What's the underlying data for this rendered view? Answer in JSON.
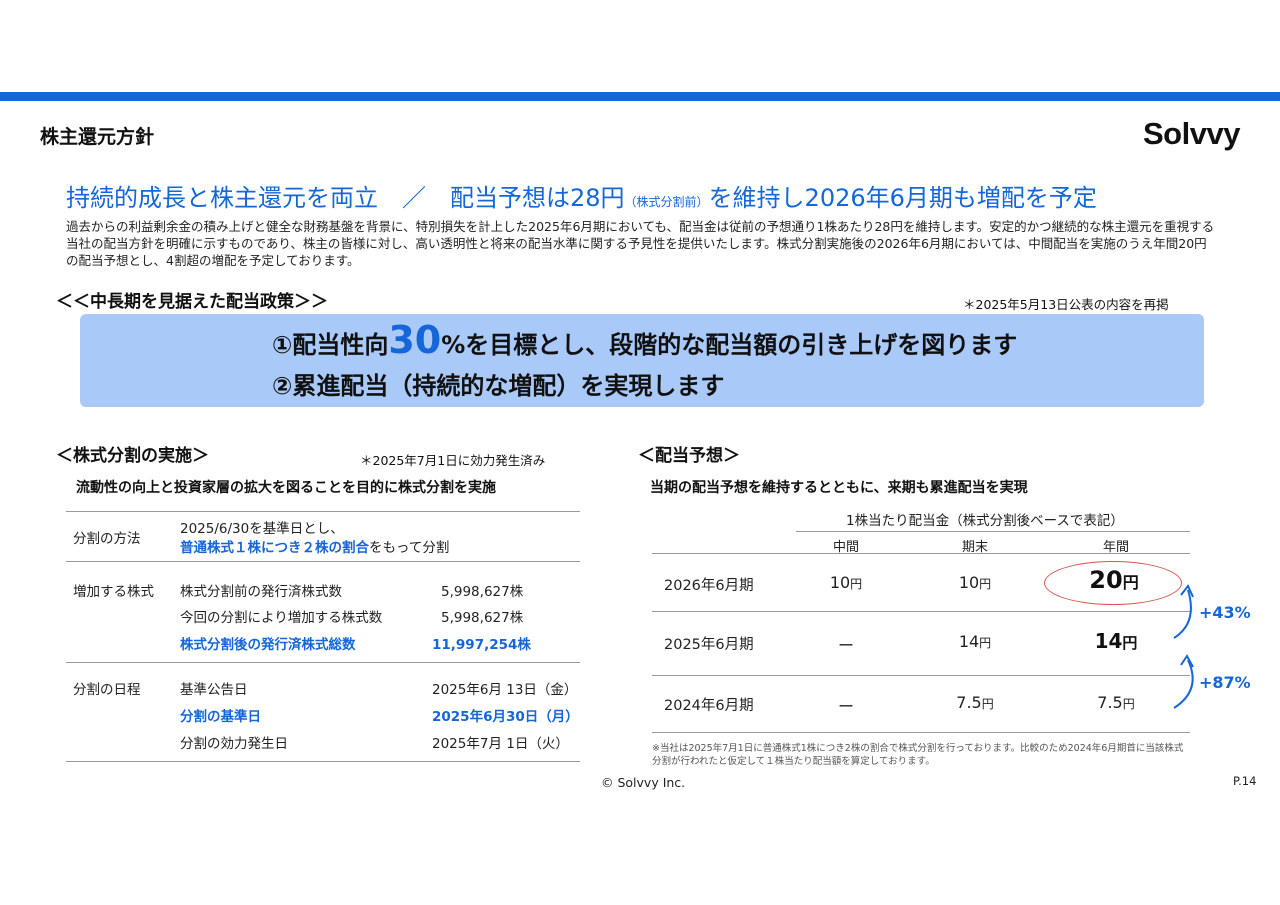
{
  "page_title": "株主還元方針",
  "logo": "Solvvy",
  "headline": {
    "part1": "持続的成長と株主還元を両立　／　配当予想は28円",
    "small": "（株式分割前）",
    "part2": "を維持し2026年6月期も増配を予定"
  },
  "intro_text": "過去からの利益剰余金の積み上げと健全な財務基盤を背景に、特別損失を計上した2025年6月期においても、配当金は従前の予想通り1株あたり28円を維持します。安定的かつ継続的な株主還元を重視する当社の配当方針を明確に示すものであり、株主の皆様に対し、高い透明性と将来の配当水準に関する予見性を提供いたします。株式分割実施後の2026年6月期においては、中間配当を実施のうえ年間20円の配当予想とし、4割超の増配を予定しております。",
  "policy": {
    "heading": "＜＜中長期を見据えた配当政策＞＞",
    "note": "＊2025年5月13日公表の内容を再掲",
    "line1_pre": "①配当性向",
    "line1_big": "30",
    "line1_post": "%を目標とし、段階的な配当額の引き上げを図ります",
    "line2": "②累進配当（持続的な増配）を実現します"
  },
  "split": {
    "heading": "＜株式分割の実施＞",
    "note": "＊2025年7月1日に効力発生済み",
    "subheading": "流動性の向上と投資家層の拡大を図ることを目的に株式分割を実施",
    "method_label": "分割の方法",
    "method_line1": "2025/6/30を基準日とし、",
    "method_line2_blue": "普通株式１株につき２株の割合",
    "method_line2_rest": "をもって分割",
    "increase_label": "増加する株式",
    "increase_rows": [
      {
        "label": "株式分割前の発行済株式数",
        "value": "5,998,627株"
      },
      {
        "label": "今回の分割により増加する株式数",
        "value": "5,998,627株"
      },
      {
        "label": "株式分割後の発行済株式総数",
        "value": "11,997,254株"
      }
    ],
    "schedule_label": "分割の日程",
    "schedule_rows": [
      {
        "label": "基準公告日",
        "value": "2025年6月 13日（金）"
      },
      {
        "label": "分割の基準日",
        "value": "2025年6月30日（月）"
      },
      {
        "label": "分割の効力発生日",
        "value": "2025年7月  1日（火）"
      }
    ]
  },
  "dividend": {
    "heading": "＜配当予想＞",
    "subheading": "当期の配当予想を維持するとともに、来期も累進配当を実現",
    "table_caption": "1株当たり配当金（株式分割後ベースで表記）",
    "columns": [
      "中間",
      "期末",
      "年間"
    ],
    "unit": "円",
    "rows": [
      {
        "period": "2026年6月期",
        "interim": "10",
        "year_end": "10",
        "annual": "20"
      },
      {
        "period": "2025年6月期",
        "interim": "ー",
        "year_end": "14",
        "annual": "14"
      },
      {
        "period": "2024年6月期",
        "interim": "ー",
        "year_end": "7.5",
        "annual": "7.5"
      }
    ],
    "growth_1": "+43%",
    "growth_2": "+87%",
    "highlight_color": "#d9534f",
    "footnote": "※当社は2025年7月1日に普通株式1株につき2株の割合で株式分割を行っております。比較のため2024年6月期首に当該株式分割が行われたと仮定して１株当たり配当額を算定しております。"
  },
  "footer": {
    "copyright": "© Solvvy Inc.",
    "page_number": "P.14"
  },
  "colors": {
    "accent": "#1566d8",
    "policy_box": "#a9c9f9"
  }
}
